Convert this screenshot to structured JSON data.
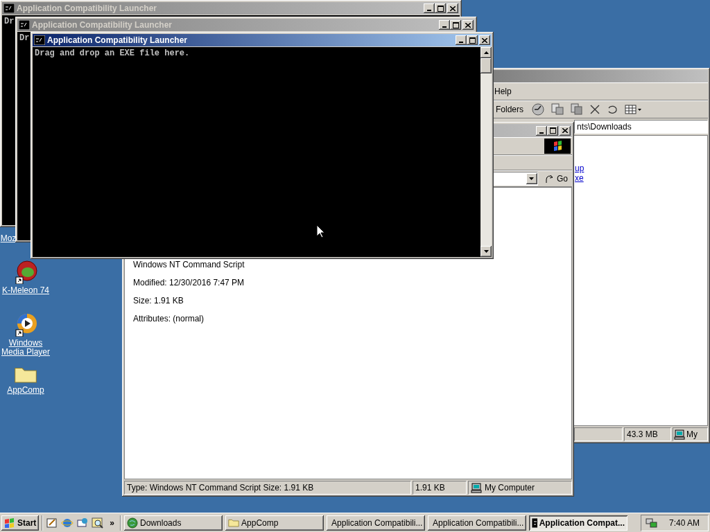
{
  "desktop_icons": [
    {
      "label": "Moz",
      "kind": "hidden"
    },
    {
      "label": "K-Meleon 74",
      "kind": "browser"
    },
    {
      "label": "Windows Media Player",
      "kind": "media"
    },
    {
      "label": "AppComp",
      "kind": "folder"
    }
  ],
  "downloads_window": {
    "menu": [
      "Help"
    ],
    "toolbar_label": "Folders",
    "address": "nts\\Downloads",
    "links": [
      "up",
      "xe"
    ],
    "status_bar": [
      "43.3 MB",
      "My"
    ]
  },
  "appcomp_window": {
    "go_button": "Go",
    "details": [
      "Windows NT Command Script",
      "Modified: 12/30/2016 7:47 PM",
      "Size: 1.91 KB",
      "Attributes: (normal)"
    ],
    "status_bar": [
      "Type: Windows NT Command Script Size: 1.91 KB",
      "1.91 KB",
      "My Computer"
    ]
  },
  "consoles": [
    {
      "title": "Application Compatibility Launcher",
      "active": false,
      "text": "Dr"
    },
    {
      "title": "Application Compatibility Launcher",
      "active": false,
      "text": "Dr"
    },
    {
      "title": "Application Compatibility Launcher",
      "active": true,
      "text": "Drag and drop an EXE file here."
    }
  ],
  "taskbar": {
    "start": "Start",
    "more": "»",
    "tasks": [
      {
        "label": "Downloads",
        "kind": "globe",
        "selected": false
      },
      {
        "label": "AppComp",
        "kind": "folder",
        "selected": false
      },
      {
        "label": "Application Compatibili...",
        "kind": "console",
        "selected": false
      },
      {
        "label": "Application Compatibili...",
        "kind": "console",
        "selected": false
      },
      {
        "label": "Application Compat...",
        "kind": "console",
        "selected": true
      }
    ],
    "clock": "7:40 AM"
  }
}
